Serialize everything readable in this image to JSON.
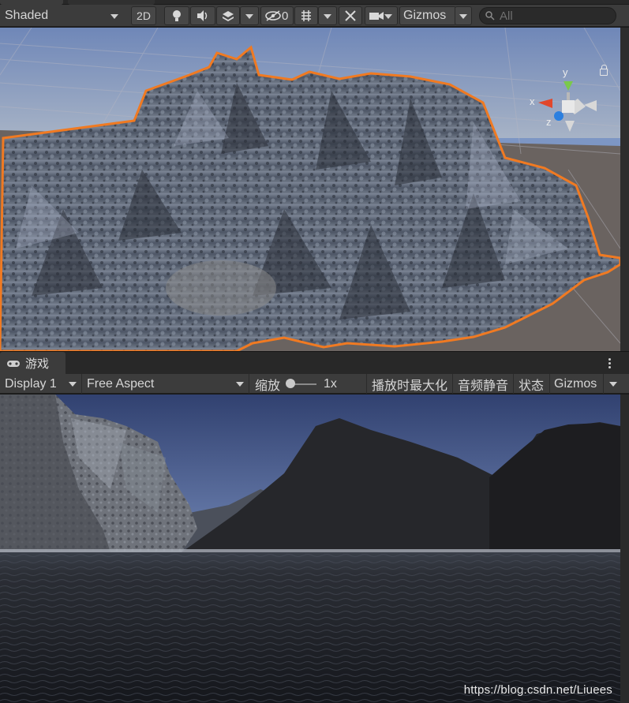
{
  "scene_toolbar": {
    "shading_mode": "Shaded",
    "mode_2d": "2D",
    "effects_count": "0",
    "gizmos_label": "Gizmos",
    "search_placeholder": "All",
    "icons": [
      "lighting-icon",
      "audio-icon",
      "effects-icon",
      "visibility-icon",
      "grid-icon",
      "tools-icon",
      "camera-icon",
      "search-icon"
    ]
  },
  "scene_view": {
    "axis_labels": {
      "x": "x",
      "y": "y",
      "z": "z"
    },
    "selection_outline_color": "#f07a22",
    "axis_colors": {
      "x": "#e2472b",
      "y": "#7ac94a",
      "z": "#2b7fe0"
    }
  },
  "game_tab": {
    "label": "游戏"
  },
  "game_toolbar": {
    "display": "Display 1",
    "aspect": "Free Aspect",
    "scale_label": "缩放",
    "scale_value": "1x",
    "maximize_on_play": "播放时最大化",
    "mute_audio": "音频静音",
    "stats": "状态",
    "gizmos_label": "Gizmos"
  },
  "watermark": "https://blog.csdn.net/Liuees"
}
